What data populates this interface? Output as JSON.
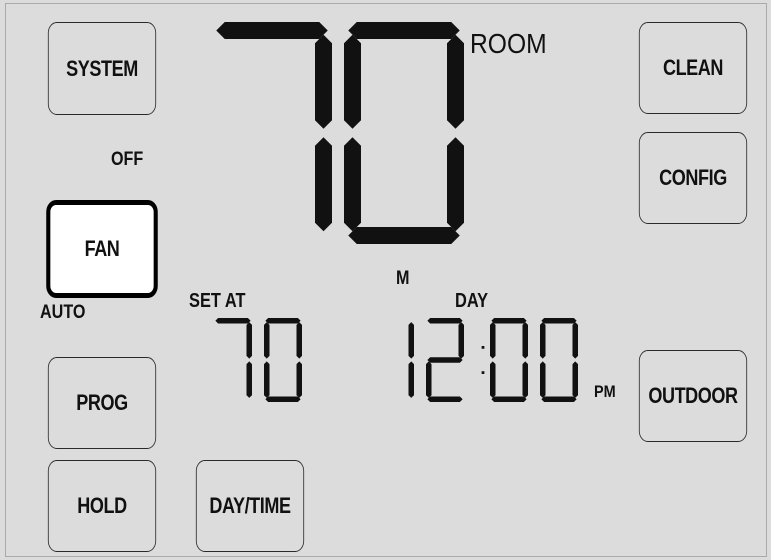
{
  "buttons": {
    "system": "SYSTEM",
    "fan": "FAN",
    "prog": "PROG",
    "hold": "HOLD",
    "day_time": "DAY/TIME",
    "clean": "CLEAN",
    "config": "CONFIG",
    "outdoor": "OUTDOOR"
  },
  "labels": {
    "system_state": "OFF",
    "fan_state": "AUTO",
    "room": "ROOM",
    "set_at": "SET AT",
    "m": "M",
    "day": "DAY",
    "pm": "PM"
  },
  "display": {
    "room_temperature": "70",
    "set_temperature": "70",
    "time": "12:00"
  },
  "colors": {
    "lcd_background": "#dcdcdc",
    "segment": "#111111",
    "active_button": "#ffffff"
  }
}
